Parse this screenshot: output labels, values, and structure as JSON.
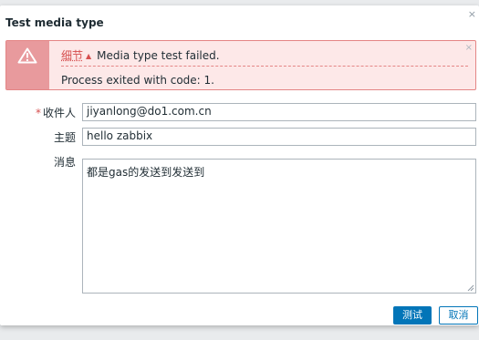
{
  "dialog": {
    "title": "Test media type",
    "close_glyph": "×"
  },
  "alert": {
    "details_label": "细节",
    "caret_glyph": "▲",
    "message": "Media type test failed.",
    "detail": "Process exited with code: 1.",
    "close_glyph": "×",
    "icon": "warning-triangle-icon",
    "colors": {
      "background": "#fde8e8",
      "border": "#e48585",
      "icon_box": "#e89a9d",
      "link": "#d64e4e"
    }
  },
  "form": {
    "required_marker": "*",
    "recipient": {
      "label": "收件人",
      "value": "jiyanlong@do1.com.cn"
    },
    "subject": {
      "label": "主题",
      "value": "hello zabbix"
    },
    "message": {
      "label": "消息",
      "value": "都是gas的发送到发送到"
    }
  },
  "buttons": {
    "test": "测试",
    "cancel": "取消",
    "colors": {
      "primary": "#0275b8"
    }
  }
}
